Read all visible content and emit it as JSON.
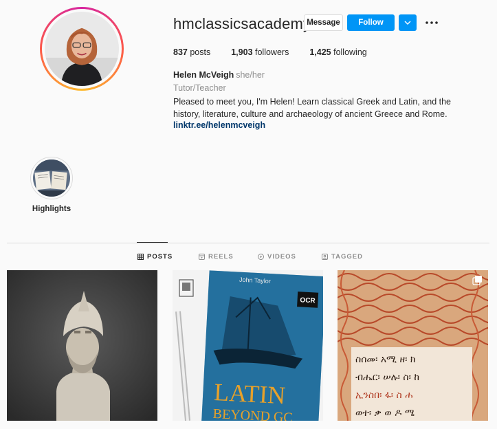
{
  "profile": {
    "username": "hmclassicsacademy",
    "message_label": "Message",
    "follow_label": "Follow",
    "stats": {
      "posts_count": "837",
      "posts_label": "posts",
      "followers_count": "1,903",
      "followers_label": "followers",
      "following_count": "1,425",
      "following_label": "following"
    },
    "full_name": "Helen McVeigh",
    "pronouns": "she/her",
    "category": "Tutor/Teacher",
    "bio": "Pleased to meet you, I'm Helen! Learn classical Greek and Latin, and the history, literature, culture and archaeology of ancient Greece and Rome.",
    "link": "linktr.ee/helenmcveigh"
  },
  "highlights": [
    {
      "label": "Highlights"
    }
  ],
  "tabs": [
    {
      "label": "POSTS",
      "icon": "grid-icon",
      "active": true
    },
    {
      "label": "REELS",
      "icon": "reels-icon",
      "active": false
    },
    {
      "label": "VIDEOS",
      "icon": "video-icon",
      "active": false
    },
    {
      "label": "TAGGED",
      "icon": "tagged-icon",
      "active": false
    }
  ],
  "posts": [
    {
      "alt": "marble bust with helmet",
      "kind": "image"
    },
    {
      "alt": "Latin Beyond GCSE book cover",
      "book_title": "LATIN",
      "book_subtitle": "BEYOND GC",
      "author": "John Taylor",
      "badge": "OCR",
      "kind": "image"
    },
    {
      "alt": "Ge'ez manuscript page",
      "script_lines": [
        "ስሰመ፡ አሚ ዘ፡ ክ",
        "ብሔር፡ ሠሉ፡ ስ፡ ከ",
        "ኢንስበ፡ ፋ፡ ስ ሐ",
        "ወተ፡ ቃ ወ ዶ ሜ"
      ],
      "kind": "carousel"
    }
  ],
  "colors": {
    "accent": "#0095f6",
    "link": "#00376b",
    "muted": "#8e8e8e",
    "text": "#262626",
    "border": "#dbdbdb"
  }
}
